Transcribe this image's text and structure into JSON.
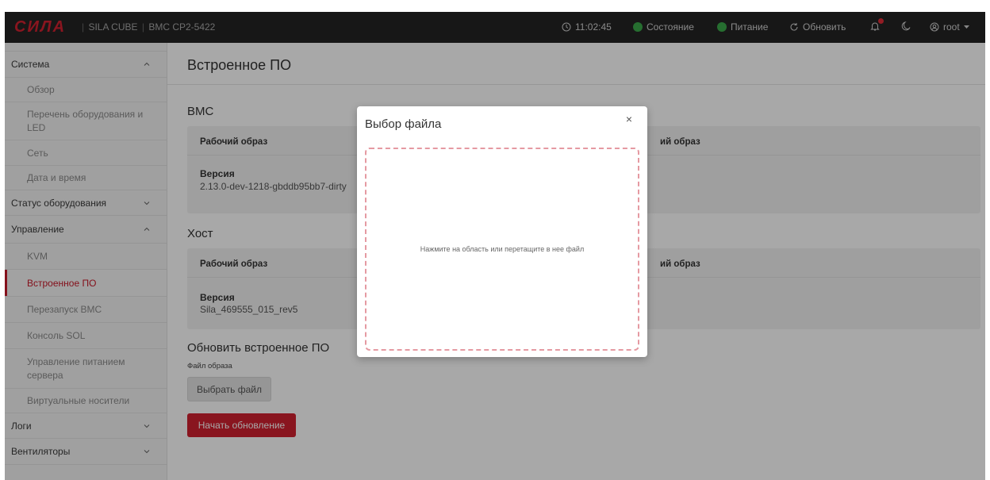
{
  "topbar": {
    "logo_text": "СИЛА",
    "product": "SILA CUBE",
    "device": "BMC CP2-5422",
    "time": "11:02:45",
    "status_label": "Состояние",
    "power_label": "Питание",
    "refresh_label": "Обновить",
    "user_label": "root",
    "accent_color": "#d2202f",
    "ok_color": "#3aa84a"
  },
  "sidebar": {
    "system": "Система",
    "overview": "Обзор",
    "hardware_line1": "Перечень оборудования и",
    "hardware_line2": "LED",
    "network": "Сеть",
    "datetime": "Дата и время",
    "hw_status": "Статус оборудования",
    "control": "Управление",
    "kvm": "KVM",
    "firmware": "Встроенное ПО",
    "bmc_reboot": "Перезапуск BMC",
    "sol_console": "Консоль SOL",
    "power_mgmt_line1": "Управление питанием",
    "power_mgmt_line2": "сервера",
    "virtual_media": "Виртуальные носители",
    "logs": "Логи",
    "fans": "Вентиляторы"
  },
  "main": {
    "title": "Встроенное ПО",
    "bmc_section": "BMC",
    "bmc_running_image": "Рабочий образ",
    "bmc_backup_image_partial": "ий образ",
    "bmc_version_label": "Версия",
    "bmc_version_value": "2.13.0-dev-1218-gbddb95bb7-dirty",
    "host_section": "Хост",
    "host_running_image": "Рабочий образ",
    "host_backup_image_partial": "ий образ",
    "host_version_label": "Версия",
    "host_version_value": "Sila_469555_015_rev5",
    "update_section": "Обновить встроенное ПО",
    "file_label": "Файл образа",
    "choose_file": "Выбрать файл",
    "start_update": "Начать обновление"
  },
  "modal": {
    "title": "Выбор файла",
    "close": "×",
    "dropzone_text": "Нажмите на область или перетащите в нее файл"
  }
}
